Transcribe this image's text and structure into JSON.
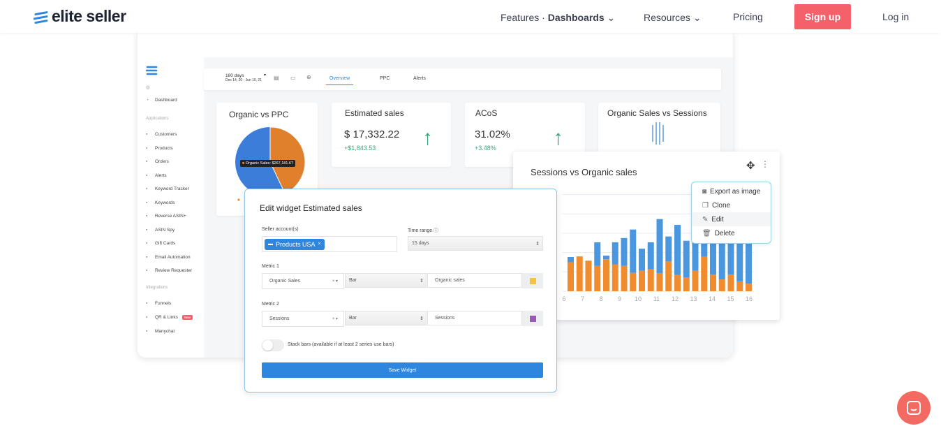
{
  "nav": {
    "brand": "elite seller",
    "features": "Features",
    "dashboards": "Dashboards",
    "resources": "Resources",
    "pricing": "Pricing",
    "signup": "Sign up",
    "login": "Log in"
  },
  "colors": {
    "accent": "#f4616b",
    "orange": "#f08c2e",
    "blue": "#4a97e0",
    "primary": "#2e86de",
    "green": "#3aa57a"
  },
  "sidebar": {
    "dashboard": "Dashboard",
    "applications": "Applications",
    "integrations": "Integrations",
    "apps": [
      {
        "icon": "users-icon",
        "label": "Customers"
      },
      {
        "icon": "box-icon",
        "label": "Products"
      },
      {
        "icon": "cart-icon",
        "label": "Orders"
      },
      {
        "icon": "bell-icon",
        "label": "Alerts"
      },
      {
        "icon": "target-icon",
        "label": "Keyword Tracker"
      },
      {
        "icon": "key-icon",
        "label": "Keywords"
      },
      {
        "icon": "search-icon",
        "label": "Reverse ASIN+"
      },
      {
        "icon": "eye-icon",
        "label": "ASIN Spy"
      },
      {
        "icon": "card-icon",
        "label": "Gift Cards"
      },
      {
        "icon": "at-icon",
        "label": "Email Automation"
      },
      {
        "icon": "chat-icon",
        "label": "Review Requester"
      }
    ],
    "ints": [
      {
        "icon": "funnel-icon",
        "label": "Funnels"
      },
      {
        "icon": "link-icon",
        "label": "QR & Links",
        "badge": "New"
      },
      {
        "icon": "chat-icon",
        "label": "Manychat"
      }
    ]
  },
  "toolbar": {
    "range": "180 days",
    "dates": "Dec 14, 20 - Jun 10, 21",
    "tabs": [
      "Overview",
      "PPC",
      "Alerts"
    ],
    "active": 0
  },
  "widgets": {
    "pie": {
      "title": "Organic vs PPC",
      "tooltip": "Organic Sales: $267,181.67",
      "organic_share": 0.43
    },
    "sales": {
      "title": "Estimated sales",
      "value": "$ 17,332.22",
      "delta": "+$1,843.53"
    },
    "acos": {
      "title": "ACoS",
      "value": "31.02%",
      "delta": "+3.48%"
    },
    "osvs": {
      "title": "Organic Sales vs Sessions"
    }
  },
  "chart_data": {
    "type": "bar",
    "stacked": true,
    "title": "Sessions vs Organic sales",
    "grid": true,
    "x_ticks": [
      "6",
      "7",
      "8",
      "9",
      "10",
      "11",
      "12",
      "13",
      "14",
      "15",
      "16"
    ],
    "series": [
      {
        "color": "#f08c2e",
        "values": [
          1.5,
          1.8,
          1.58,
          1.31,
          1.65,
          1.39,
          1.31,
          0.95,
          1.06,
          1.14,
          0.94,
          1.54,
          0.84,
          0.72,
          1.06,
          1.78,
          0.86,
          0.61,
          0.86,
          0.5,
          0.39
        ]
      },
      {
        "color": "#4a97e0",
        "values": [
          0.27,
          0,
          0,
          1.22,
          0.19,
          1.14,
          1.44,
          2.24,
          1.14,
          1.39,
          2.79,
          1.29,
          2.59,
          1.89,
          2.3,
          1.2,
          2.1,
          2.5,
          2.1,
          2.6,
          2.5
        ]
      }
    ],
    "ylim": [
      0,
      5
    ]
  },
  "menu": [
    {
      "icon": "camera-icon",
      "label": "Export as image"
    },
    {
      "icon": "clone-icon",
      "label": "Clone"
    },
    {
      "icon": "edit-icon",
      "label": "Edit"
    },
    {
      "icon": "trash-icon",
      "label": "Delete"
    }
  ],
  "dialog": {
    "title": "Edit widget Estimated sales",
    "seller_label": "Seller account(s)",
    "seller_chip": "Products USA",
    "time_label": "Time range",
    "time_value": "15 days",
    "metric1_label": "Metric 1",
    "metric1": "Organic Sales",
    "metric1_type": "Bar",
    "metric1_name": "Organic sales",
    "metric1_color": "#f5c242",
    "metric2_label": "Metric 2",
    "metric2": "Sessions",
    "metric2_type": "Bar",
    "metric2_name": "Sessions",
    "metric2_color": "#9b59b6",
    "stack_label": "Stack bars (available if at least 2 series use bars)",
    "stack_on": false,
    "save": "Save Widget"
  }
}
